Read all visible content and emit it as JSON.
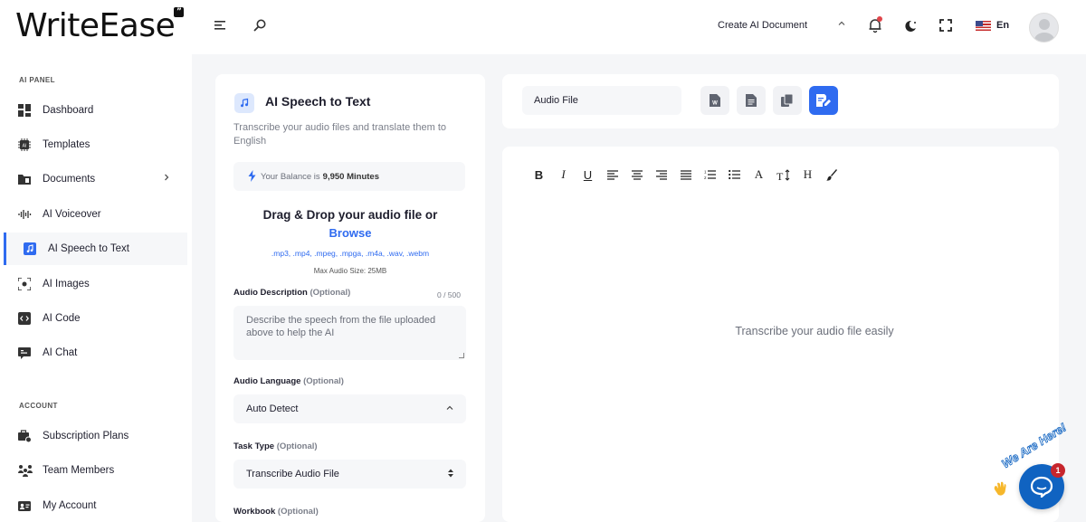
{
  "app": {
    "logo": "WriteEase",
    "logo_badge": "”"
  },
  "topbar": {
    "create_document": "Create AI Document",
    "language": "En"
  },
  "sidebar": {
    "ai_panel_title": "AI PANEL",
    "items": [
      {
        "label": "Dashboard",
        "icon": "dashboard-icon"
      },
      {
        "label": "Templates",
        "icon": "templates-icon"
      },
      {
        "label": "Documents",
        "icon": "documents-icon"
      },
      {
        "label": "AI Voiceover",
        "icon": "voiceover-icon"
      },
      {
        "label": "AI Speech to Text",
        "icon": "speech-to-text-icon"
      },
      {
        "label": "AI Images",
        "icon": "images-icon"
      },
      {
        "label": "AI Code",
        "icon": "code-icon"
      },
      {
        "label": "AI Chat",
        "icon": "chat-icon"
      }
    ],
    "account_title": "ACCOUNT",
    "account_items": [
      {
        "label": "Subscription Plans",
        "icon": "subscription-icon"
      },
      {
        "label": "Team Members",
        "icon": "team-icon"
      },
      {
        "label": "My Account",
        "icon": "account-icon"
      }
    ]
  },
  "form": {
    "title": "AI Speech to Text",
    "description": "Transcribe your audio files and translate them to English",
    "balance_prefix": "Your Balance is",
    "balance_value": "9,950 Minutes",
    "drop_title": "Drag & Drop your audio file or",
    "browse": "Browse",
    "formats": ".mp3, .mp4, .mpeg, .mpga, .m4a, .wav, .webm",
    "max_size": "Max Audio Size: 25MB",
    "description_label": "Audio Description",
    "optional": "(Optional)",
    "counter": "0 / 500",
    "description_placeholder": "Describe the speech from the file uploaded above to help the AI",
    "language_label": "Audio Language",
    "language_value": "Auto Detect",
    "task_label": "Task Type",
    "task_value": "Transcribe Audio File",
    "workbook_label": "Workbook"
  },
  "result": {
    "file_name": "Audio File",
    "placeholder": "Transcribe your audio file easily",
    "toolbar": [
      "B",
      "I",
      "U",
      "align-left",
      "align-center",
      "align-right",
      "align-justify",
      "ordered-list",
      "bullet-list",
      "A",
      "line-height",
      "H",
      "brush"
    ]
  },
  "chat_widget": {
    "label": "We Are Here!",
    "badge": "1"
  },
  "colors": {
    "accent": "#2f6bf0",
    "chat": "#1063c1",
    "notification": "#e0454a"
  }
}
